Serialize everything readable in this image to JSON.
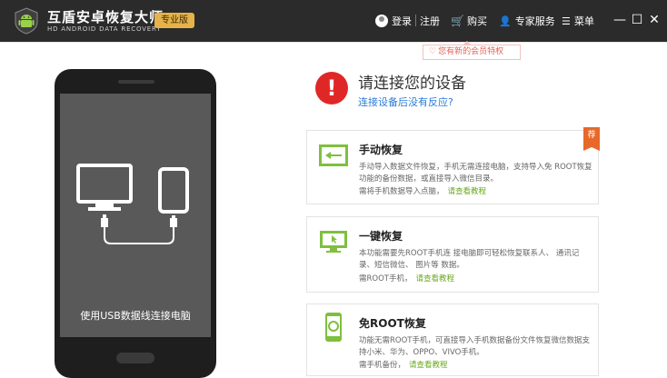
{
  "app": {
    "title": "互盾安卓恢复大师",
    "subtitle": "HD ANDROID DATA RECOVERY",
    "edition": "专业版"
  },
  "toolbar": {
    "login": "登录",
    "register": "注册",
    "buy": "购买",
    "expert": "专家服务",
    "menu": "菜单",
    "tooltip": "您有新的会员特权"
  },
  "window_buttons": {
    "minimize": "—",
    "maximize": "☐",
    "close": "✕"
  },
  "phone": {
    "caption": "使用USB数据线连接电脑"
  },
  "main": {
    "title": "请连接您的设备",
    "help_link": "连接设备后没有反应?"
  },
  "cards": [
    {
      "title": "手动恢复",
      "desc": "手动导入数据文件恢复，手机无需连接电脑，支持导入免 ROOT恢复功能的备份数据，或直接导入微信目录。",
      "foot": "需将手机数据导入点脑，",
      "link": "请查看教程",
      "badge": "荐"
    },
    {
      "title": "一键恢复",
      "desc": "本功能需要先ROOT手机连 接电脑即可轻松恢复联系人、 通讯记录、短信微信、 图片等 数据。",
      "foot": "需ROOT手机，",
      "link": "请查看教程"
    },
    {
      "title": "免ROOT恢复",
      "desc": "功能无需ROOT手机，可直接导入手机数据备份文件恢复微信数据支持小米、华为、OPPO、VIVO手机。",
      "foot": "需手机备份，",
      "link": "请查看教程"
    }
  ]
}
